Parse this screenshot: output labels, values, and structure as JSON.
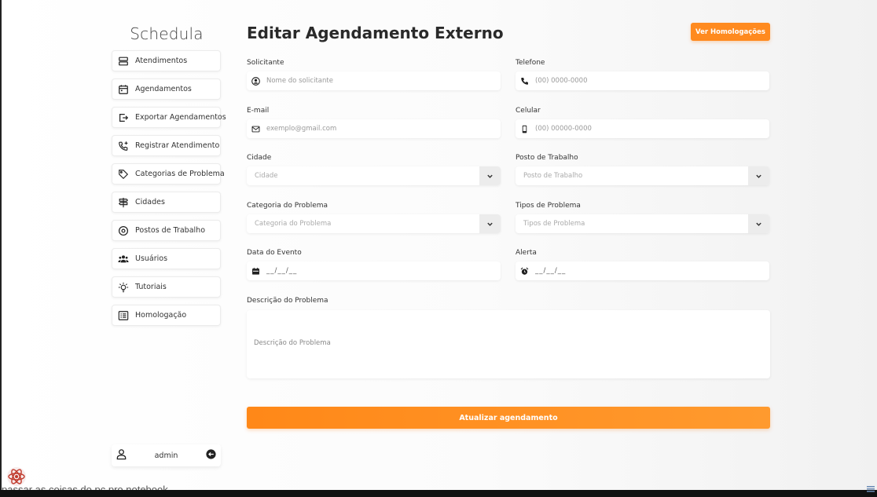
{
  "brand": "Schedula",
  "sidebar": {
    "items": [
      {
        "label": "Atendimentos",
        "icon": "server-icon"
      },
      {
        "label": "Agendamentos",
        "icon": "calendar-icon"
      },
      {
        "label": "Exportar Agendamentos",
        "icon": "export-icon"
      },
      {
        "label": "Registrar Atendimento",
        "icon": "phone-add-icon"
      },
      {
        "label": "Categorias de Problema",
        "icon": "tag-icon"
      },
      {
        "label": "Cidades",
        "icon": "signpost-icon"
      },
      {
        "label": "Postos de Trabalho",
        "icon": "location-pin-icon"
      },
      {
        "label": "Usuários",
        "icon": "users-icon"
      },
      {
        "label": "Tutoriais",
        "icon": "lightbulb-icon"
      },
      {
        "label": "Homologação",
        "icon": "checklist-icon"
      }
    ],
    "user": {
      "name": "admin",
      "icon": "user-icon",
      "logout_icon": "logout-icon"
    }
  },
  "header": {
    "title": "Editar Agendamento Externo",
    "homolog_button": "Ver Homologações"
  },
  "form": {
    "solicitante": {
      "label": "Solicitante",
      "placeholder": "Nome do solicitante",
      "value": ""
    },
    "telefone": {
      "label": "Telefone",
      "placeholder": "(00) 0000-0000",
      "value": ""
    },
    "email": {
      "label": "E-mail",
      "placeholder": "exemplo@gmail.com",
      "value": ""
    },
    "celular": {
      "label": "Celular",
      "placeholder": "(00) 00000-0000",
      "value": ""
    },
    "cidade": {
      "label": "Cidade",
      "placeholder": "Cidade"
    },
    "posto": {
      "label": "Posto de Trabalho",
      "placeholder": "Posto de Trabalho"
    },
    "categoria": {
      "label": "Categoria do Problema",
      "placeholder": "Categoria do Problema"
    },
    "tipos": {
      "label": "Tipos de Problema",
      "placeholder": "Tipos de Problema"
    },
    "data_evento": {
      "label": "Data do Evento",
      "value": "__/__/__"
    },
    "alerta": {
      "label": "Alerta",
      "value": "__/__/__"
    },
    "descricao": {
      "label": "Descrição do Problema",
      "placeholder": "Descrição do Problema"
    },
    "submit": "Atualizar agendamento"
  },
  "bottom_caption": "passar as coisas do pc pro notebook",
  "colors": {
    "accent": "#ff8a1f",
    "accent_light": "#ff9a2e"
  }
}
